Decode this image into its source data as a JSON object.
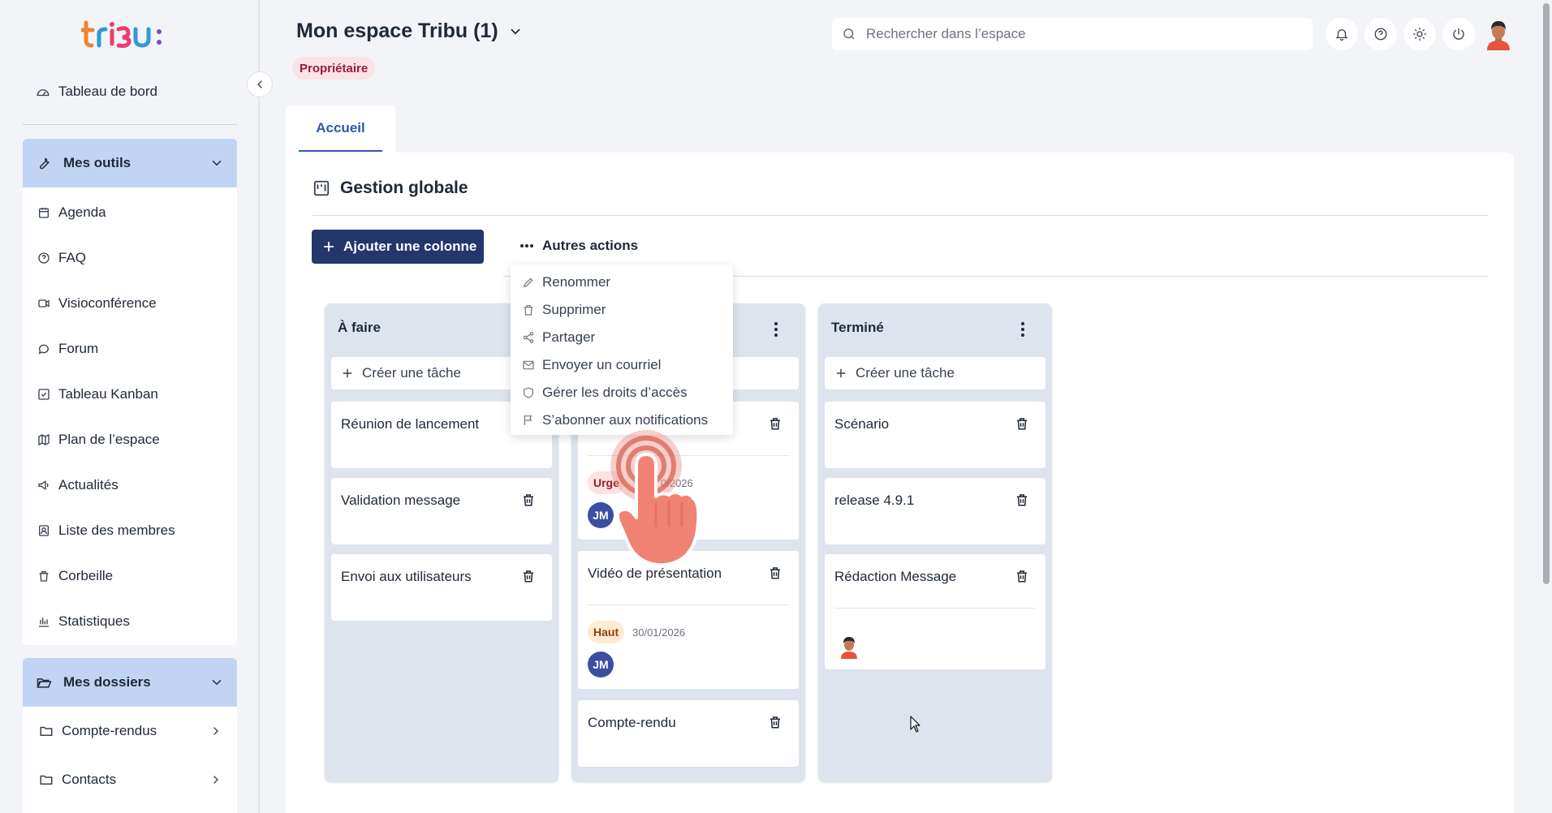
{
  "app": {
    "logo_text": "tribu:",
    "brand_colors": {
      "orange": "#f0852d",
      "blue": "#2e9bd6",
      "pink": "#e83e6e",
      "purple": "#7b4fc4",
      "primary": "#23376b",
      "accent": "#2f56b0"
    }
  },
  "sidebar": {
    "dashboard": {
      "label": "Tableau de bord",
      "icon": "gauge-icon"
    },
    "tools": {
      "label": "Mes outils",
      "icon": "wrench-icon",
      "items": [
        {
          "label": "Agenda",
          "icon": "calendar-icon"
        },
        {
          "label": "FAQ",
          "icon": "help-circle-icon"
        },
        {
          "label": "Visioconférence",
          "icon": "video-icon"
        },
        {
          "label": "Forum",
          "icon": "chat-bubble-icon"
        },
        {
          "label": "Tableau Kanban",
          "icon": "checkbox-icon"
        },
        {
          "label": "Plan de l’espace",
          "icon": "map-icon"
        },
        {
          "label": "Actualités",
          "icon": "megaphone-icon"
        },
        {
          "label": "Liste des membres",
          "icon": "contact-card-icon"
        },
        {
          "label": "Corbeille",
          "icon": "trash-icon"
        },
        {
          "label": "Statistiques",
          "icon": "bar-chart-icon"
        }
      ]
    },
    "folders": {
      "label": "Mes dossiers",
      "icon": "folder-open-icon",
      "items": [
        {
          "label": "Compte-rendus",
          "icon": "folder-icon"
        },
        {
          "label": "Contacts",
          "icon": "folder-icon"
        }
      ]
    }
  },
  "header": {
    "workspace_title": "Mon espace Tribu (1)",
    "role_badge": "Propriétaire",
    "search_placeholder": "Rechercher dans l’espace",
    "icons": [
      "bell-icon",
      "help-circle-icon",
      "sun-icon",
      "power-icon",
      "user-avatar"
    ]
  },
  "tabs": [
    {
      "label": "Accueil",
      "active": true
    }
  ],
  "board": {
    "title": "Gestion globale",
    "add_column_label": "Ajouter une colonne",
    "more_actions_label": "Autres actions",
    "menu": [
      {
        "label": "Renommer",
        "icon": "pencil-icon"
      },
      {
        "label": "Supprimer",
        "icon": "trash-icon"
      },
      {
        "label": "Partager",
        "icon": "share-icon"
      },
      {
        "label": "Envoyer un courriel",
        "icon": "mail-icon"
      },
      {
        "label": "Gérer les droits d’accès",
        "icon": "shield-icon"
      },
      {
        "label": "S’abonner aux notifications",
        "icon": "flag-icon"
      }
    ],
    "create_task_label": "Créer une tâche",
    "columns": [
      {
        "title": "À faire",
        "cards": [
          {
            "title": "Réunion de lancement"
          },
          {
            "title": "Validation message"
          },
          {
            "title": "Envoi aux utilisateurs"
          }
        ]
      },
      {
        "title": "",
        "cards": [
          {
            "title": "",
            "priority": "Urge",
            "due": "0/2026",
            "assignee": "JM"
          },
          {
            "title": "Vidéo de présentation",
            "priority": "Haut",
            "due": "30/01/2026",
            "assignee": "JM"
          },
          {
            "title": "Compte-rendu"
          }
        ]
      },
      {
        "title": "Terminé",
        "cards": [
          {
            "title": "Scénario"
          },
          {
            "title": "release 4.9.1"
          },
          {
            "title": "Rédaction Message",
            "assignee_avatar": true
          }
        ]
      }
    ]
  }
}
